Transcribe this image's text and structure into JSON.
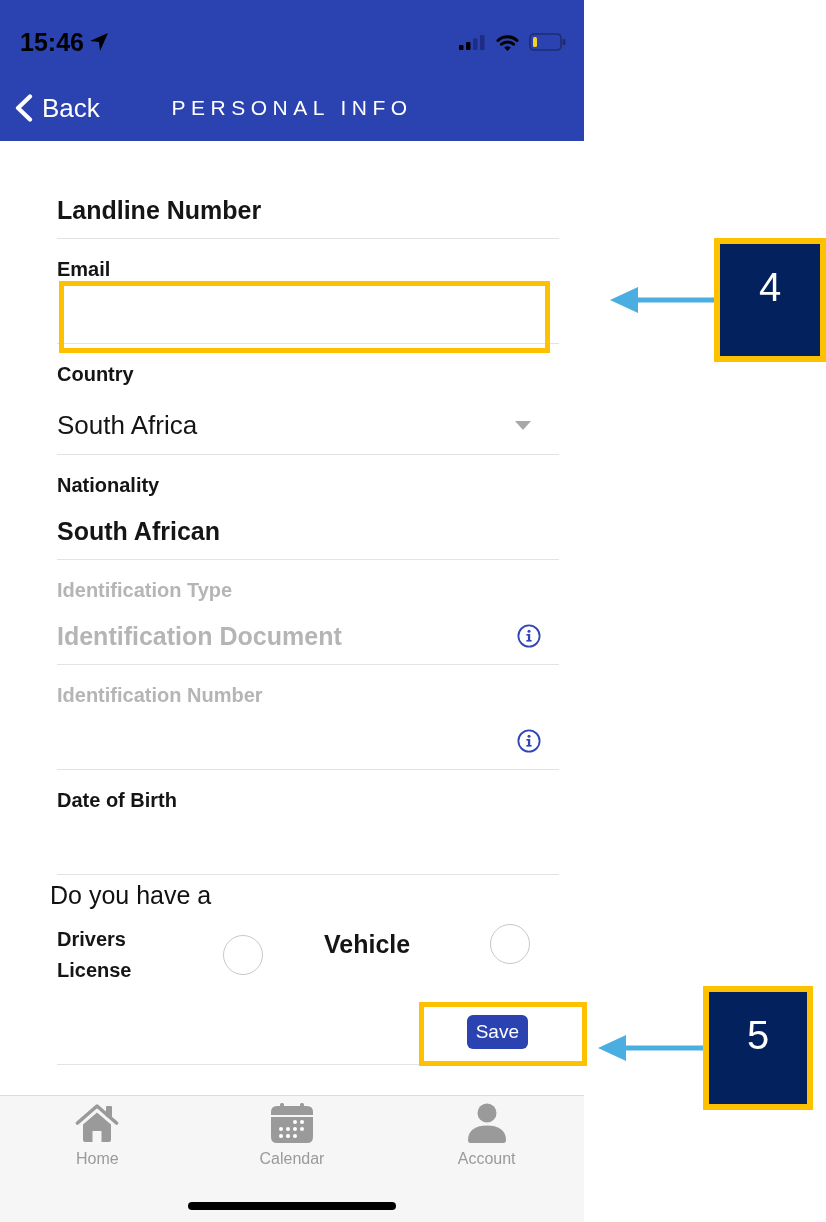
{
  "status_bar": {
    "time": "15:46"
  },
  "nav_bar": {
    "back_label": "Back",
    "title": "PERSONAL INFO"
  },
  "fields": [
    {
      "kind": "text",
      "value": "Landline Number",
      "disabled": false,
      "info": false
    },
    {
      "kind": "text",
      "label": "Email",
      "disabled": false,
      "info": false
    },
    {
      "kind": "dropdown",
      "label": "Country",
      "value": "South Africa",
      "disabled": false,
      "info": false
    },
    {
      "kind": "text",
      "label": "Nationality",
      "value": "South African",
      "disabled": false,
      "info": false
    },
    {
      "kind": "text",
      "label": "Identification Type",
      "placeholder": "Identification Document",
      "disabled": true,
      "info": true
    },
    {
      "kind": "text",
      "label": "Identification Number",
      "disabled": true,
      "info": true
    },
    {
      "kind": "text",
      "label": "Date of Birth",
      "disabled": false,
      "info": false
    }
  ],
  "ownership": {
    "question": "Do you have a",
    "options": [
      {
        "label": "Drivers License",
        "checked": false
      },
      {
        "label": "Vehicle",
        "checked": false
      }
    ]
  },
  "save_button": {
    "label": "Save"
  },
  "tab_bar": {
    "tabs": [
      {
        "label": "Home",
        "selected": false
      },
      {
        "label": "Calendar",
        "selected": false
      },
      {
        "label": "Account",
        "selected": false
      }
    ]
  },
  "callouts": [
    {
      "number": "4"
    },
    {
      "number": "5"
    }
  ]
}
